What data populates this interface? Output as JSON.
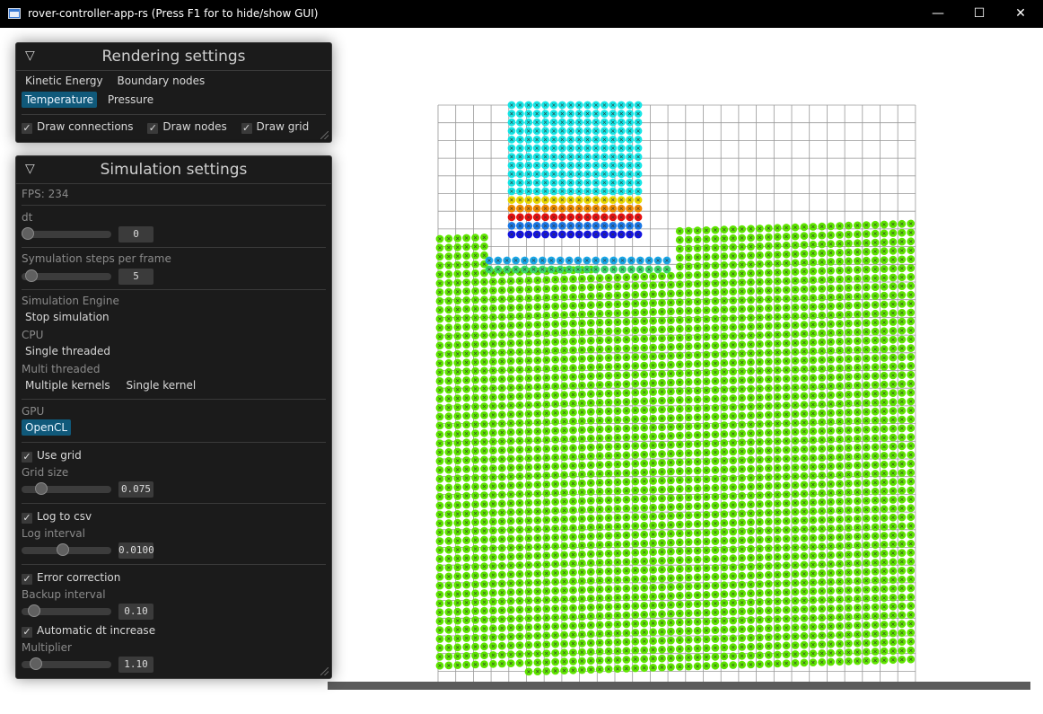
{
  "window": {
    "title": "rover-controller-app-rs (Press F1 for to hide/show GUI)",
    "minimize_glyph": "—",
    "maximize_glyph": "☐",
    "close_glyph": "✕"
  },
  "rendering": {
    "title": "Rendering settings",
    "collapse_glyph": "▽",
    "modes": [
      "Kinetic Energy",
      "Boundary nodes",
      "Temperature",
      "Pressure"
    ],
    "selected_mode": "Temperature",
    "draw_connections": "Draw connections",
    "draw_nodes": "Draw nodes",
    "draw_grid": "Draw grid",
    "check_glyph": "✓"
  },
  "simulation": {
    "title": "Simulation settings",
    "collapse_glyph": "▽",
    "fps": "FPS: 234",
    "dt_label": "dt",
    "dt_value": "0",
    "dt_level": 0.0,
    "steps_label": "Symulation steps per frame",
    "steps_value": "5",
    "steps_level": 0.05,
    "engine_label": "Simulation Engine",
    "stop_label": "Stop simulation",
    "cpu_label": "CPU",
    "single_threaded": "Single threaded",
    "multi_label": "Multi threaded",
    "multiple_kernels": "Multiple kernels",
    "single_kernel": "Single kernel",
    "gpu_label": "GPU",
    "opencl": "OpenCL",
    "use_grid": "Use grid",
    "grid_size_label": "Grid size",
    "grid_size_value": "0.075",
    "grid_size_level": 0.18,
    "log_csv": "Log to csv",
    "log_interval_label": "Log interval",
    "log_interval_value": "0.0100",
    "log_interval_level": 0.45,
    "error_correction": "Error correction",
    "backup_interval_label": "Backup interval",
    "backup_interval_value": "0.10",
    "backup_interval_level": 0.08,
    "auto_dt": "Automatic dt increase",
    "multiplier_label": "Multiplier",
    "multiplier_value": "1.10",
    "multiplier_level": 0.1
  },
  "colors": {
    "selected_bg": "#10597a",
    "node_green": "#5fe600",
    "node_cyan": "#16e6e6",
    "node_red": "#e81010",
    "node_blue": "#1414e0",
    "node_orange": "#f08a00",
    "node_yellow": "#e8d800",
    "grid_line": "#9a9a9a"
  }
}
